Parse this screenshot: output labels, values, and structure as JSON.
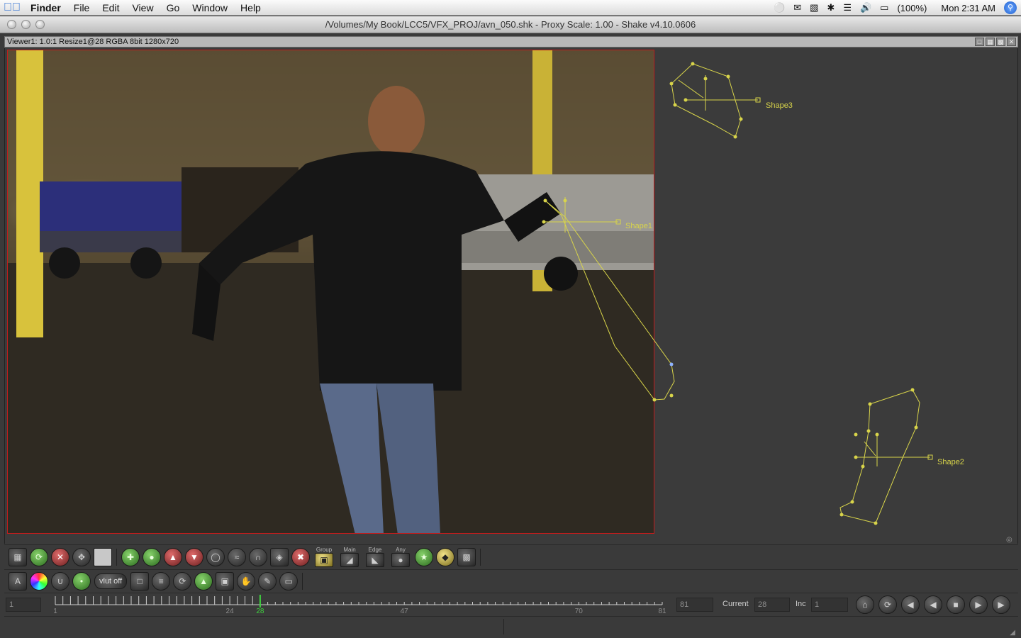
{
  "menubar": {
    "app_name": "Finder",
    "items": [
      "File",
      "Edit",
      "View",
      "Go",
      "Window",
      "Help"
    ],
    "battery": "(100%)",
    "clock": "Mon 2:31 AM"
  },
  "window": {
    "title": "/Volumes/My Book/LCC5/VFX_PROJ/avn_050.shk - Proxy Scale: 1.00 - Shake v4.10.0606"
  },
  "viewer": {
    "header": "Viewer1: 1.0:1 Resize1@28 RGBA 8bit 1280x720",
    "shapes": [
      {
        "name": "Shape3"
      },
      {
        "name": "Shape1"
      },
      {
        "name": "Shape2"
      }
    ]
  },
  "toolbar": {
    "group_label": "Group",
    "main_label": "Main",
    "edge_label": "Edge",
    "any_label": "Any",
    "a_label": "A",
    "vlut_label": "vlut off"
  },
  "timebar": {
    "start_frame": "1",
    "end_frame": "81",
    "current_label": "Current",
    "current_value": "28",
    "inc_label": "Inc",
    "inc_value": "1",
    "ticks": [
      "1",
      "24",
      "28",
      "47",
      "70",
      "81"
    ]
  },
  "colors": {
    "shape_yellow": "#d8d44a",
    "frame_border": "#c21c1c",
    "current_frame": "#3fd33f"
  }
}
